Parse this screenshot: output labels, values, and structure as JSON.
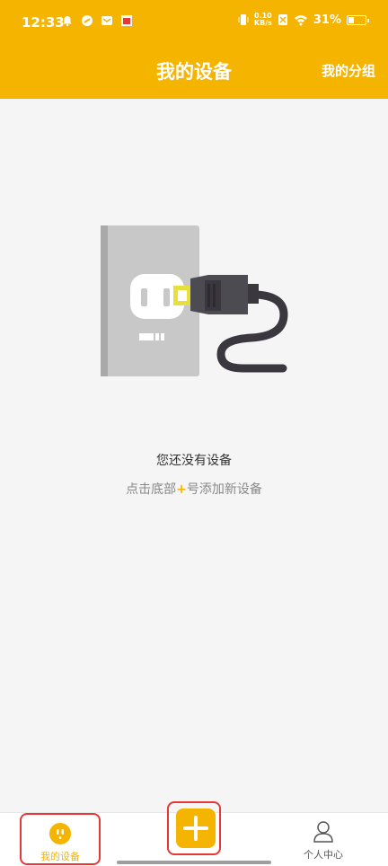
{
  "status_bar": {
    "time": "12:33",
    "net_speed_value": "0.10",
    "net_speed_unit": "KB/s",
    "battery_percent": "31%"
  },
  "app_bar": {
    "title": "我的设备",
    "action_label": "我的分组"
  },
  "empty_state": {
    "title": "您还没有设备",
    "hint_prefix": "点击底部",
    "hint_plus": "+",
    "hint_suffix": "号添加新设备"
  },
  "tabs": {
    "devices_label": "我的设备",
    "profile_label": "个人中心"
  },
  "colors": {
    "accent": "#f5b400",
    "highlight_outline": "#e53935"
  },
  "icons": {
    "devices_tab": "socket-icon",
    "profile_tab": "person-icon",
    "add": "plus-icon"
  }
}
